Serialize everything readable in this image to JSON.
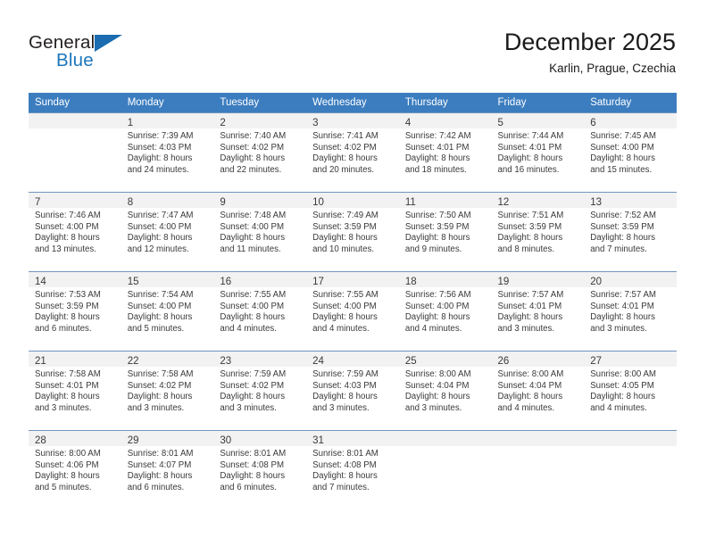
{
  "brand": {
    "word_one": "General",
    "word_two": "Blue",
    "logo_icon": "triangle-logo-icon",
    "colors": {
      "blue": "#1b75bb",
      "dark": "#231f20"
    }
  },
  "header": {
    "title": "December 2025",
    "subtitle": "Karlin, Prague, Czechia"
  },
  "theme": {
    "header_bg": "#3c7dbf",
    "header_text": "#ffffff",
    "daynum_band_bg": "#f2f2f2",
    "grid_line": "#5a86b5",
    "body_text": "#3a3a3a"
  },
  "weekday_headers": [
    "Sunday",
    "Monday",
    "Tuesday",
    "Wednesday",
    "Thursday",
    "Friday",
    "Saturday"
  ],
  "weeks": [
    [
      {
        "day": "",
        "lines": []
      },
      {
        "day": "1",
        "lines": [
          "Sunrise: 7:39 AM",
          "Sunset: 4:03 PM",
          "Daylight: 8 hours",
          "and 24 minutes."
        ]
      },
      {
        "day": "2",
        "lines": [
          "Sunrise: 7:40 AM",
          "Sunset: 4:02 PM",
          "Daylight: 8 hours",
          "and 22 minutes."
        ]
      },
      {
        "day": "3",
        "lines": [
          "Sunrise: 7:41 AM",
          "Sunset: 4:02 PM",
          "Daylight: 8 hours",
          "and 20 minutes."
        ]
      },
      {
        "day": "4",
        "lines": [
          "Sunrise: 7:42 AM",
          "Sunset: 4:01 PM",
          "Daylight: 8 hours",
          "and 18 minutes."
        ]
      },
      {
        "day": "5",
        "lines": [
          "Sunrise: 7:44 AM",
          "Sunset: 4:01 PM",
          "Daylight: 8 hours",
          "and 16 minutes."
        ]
      },
      {
        "day": "6",
        "lines": [
          "Sunrise: 7:45 AM",
          "Sunset: 4:00 PM",
          "Daylight: 8 hours",
          "and 15 minutes."
        ]
      }
    ],
    [
      {
        "day": "7",
        "lines": [
          "Sunrise: 7:46 AM",
          "Sunset: 4:00 PM",
          "Daylight: 8 hours",
          "and 13 minutes."
        ]
      },
      {
        "day": "8",
        "lines": [
          "Sunrise: 7:47 AM",
          "Sunset: 4:00 PM",
          "Daylight: 8 hours",
          "and 12 minutes."
        ]
      },
      {
        "day": "9",
        "lines": [
          "Sunrise: 7:48 AM",
          "Sunset: 4:00 PM",
          "Daylight: 8 hours",
          "and 11 minutes."
        ]
      },
      {
        "day": "10",
        "lines": [
          "Sunrise: 7:49 AM",
          "Sunset: 3:59 PM",
          "Daylight: 8 hours",
          "and 10 minutes."
        ]
      },
      {
        "day": "11",
        "lines": [
          "Sunrise: 7:50 AM",
          "Sunset: 3:59 PM",
          "Daylight: 8 hours",
          "and 9 minutes."
        ]
      },
      {
        "day": "12",
        "lines": [
          "Sunrise: 7:51 AM",
          "Sunset: 3:59 PM",
          "Daylight: 8 hours",
          "and 8 minutes."
        ]
      },
      {
        "day": "13",
        "lines": [
          "Sunrise: 7:52 AM",
          "Sunset: 3:59 PM",
          "Daylight: 8 hours",
          "and 7 minutes."
        ]
      }
    ],
    [
      {
        "day": "14",
        "lines": [
          "Sunrise: 7:53 AM",
          "Sunset: 3:59 PM",
          "Daylight: 8 hours",
          "and 6 minutes."
        ]
      },
      {
        "day": "15",
        "lines": [
          "Sunrise: 7:54 AM",
          "Sunset: 4:00 PM",
          "Daylight: 8 hours",
          "and 5 minutes."
        ]
      },
      {
        "day": "16",
        "lines": [
          "Sunrise: 7:55 AM",
          "Sunset: 4:00 PM",
          "Daylight: 8 hours",
          "and 4 minutes."
        ]
      },
      {
        "day": "17",
        "lines": [
          "Sunrise: 7:55 AM",
          "Sunset: 4:00 PM",
          "Daylight: 8 hours",
          "and 4 minutes."
        ]
      },
      {
        "day": "18",
        "lines": [
          "Sunrise: 7:56 AM",
          "Sunset: 4:00 PM",
          "Daylight: 8 hours",
          "and 4 minutes."
        ]
      },
      {
        "day": "19",
        "lines": [
          "Sunrise: 7:57 AM",
          "Sunset: 4:01 PM",
          "Daylight: 8 hours",
          "and 3 minutes."
        ]
      },
      {
        "day": "20",
        "lines": [
          "Sunrise: 7:57 AM",
          "Sunset: 4:01 PM",
          "Daylight: 8 hours",
          "and 3 minutes."
        ]
      }
    ],
    [
      {
        "day": "21",
        "lines": [
          "Sunrise: 7:58 AM",
          "Sunset: 4:01 PM",
          "Daylight: 8 hours",
          "and 3 minutes."
        ]
      },
      {
        "day": "22",
        "lines": [
          "Sunrise: 7:58 AM",
          "Sunset: 4:02 PM",
          "Daylight: 8 hours",
          "and 3 minutes."
        ]
      },
      {
        "day": "23",
        "lines": [
          "Sunrise: 7:59 AM",
          "Sunset: 4:02 PM",
          "Daylight: 8 hours",
          "and 3 minutes."
        ]
      },
      {
        "day": "24",
        "lines": [
          "Sunrise: 7:59 AM",
          "Sunset: 4:03 PM",
          "Daylight: 8 hours",
          "and 3 minutes."
        ]
      },
      {
        "day": "25",
        "lines": [
          "Sunrise: 8:00 AM",
          "Sunset: 4:04 PM",
          "Daylight: 8 hours",
          "and 3 minutes."
        ]
      },
      {
        "day": "26",
        "lines": [
          "Sunrise: 8:00 AM",
          "Sunset: 4:04 PM",
          "Daylight: 8 hours",
          "and 4 minutes."
        ]
      },
      {
        "day": "27",
        "lines": [
          "Sunrise: 8:00 AM",
          "Sunset: 4:05 PM",
          "Daylight: 8 hours",
          "and 4 minutes."
        ]
      }
    ],
    [
      {
        "day": "28",
        "lines": [
          "Sunrise: 8:00 AM",
          "Sunset: 4:06 PM",
          "Daylight: 8 hours",
          "and 5 minutes."
        ]
      },
      {
        "day": "29",
        "lines": [
          "Sunrise: 8:01 AM",
          "Sunset: 4:07 PM",
          "Daylight: 8 hours",
          "and 6 minutes."
        ]
      },
      {
        "day": "30",
        "lines": [
          "Sunrise: 8:01 AM",
          "Sunset: 4:08 PM",
          "Daylight: 8 hours",
          "and 6 minutes."
        ]
      },
      {
        "day": "31",
        "lines": [
          "Sunrise: 8:01 AM",
          "Sunset: 4:08 PM",
          "Daylight: 8 hours",
          "and 7 minutes."
        ]
      },
      {
        "day": "",
        "lines": []
      },
      {
        "day": "",
        "lines": []
      },
      {
        "day": "",
        "lines": []
      }
    ]
  ]
}
